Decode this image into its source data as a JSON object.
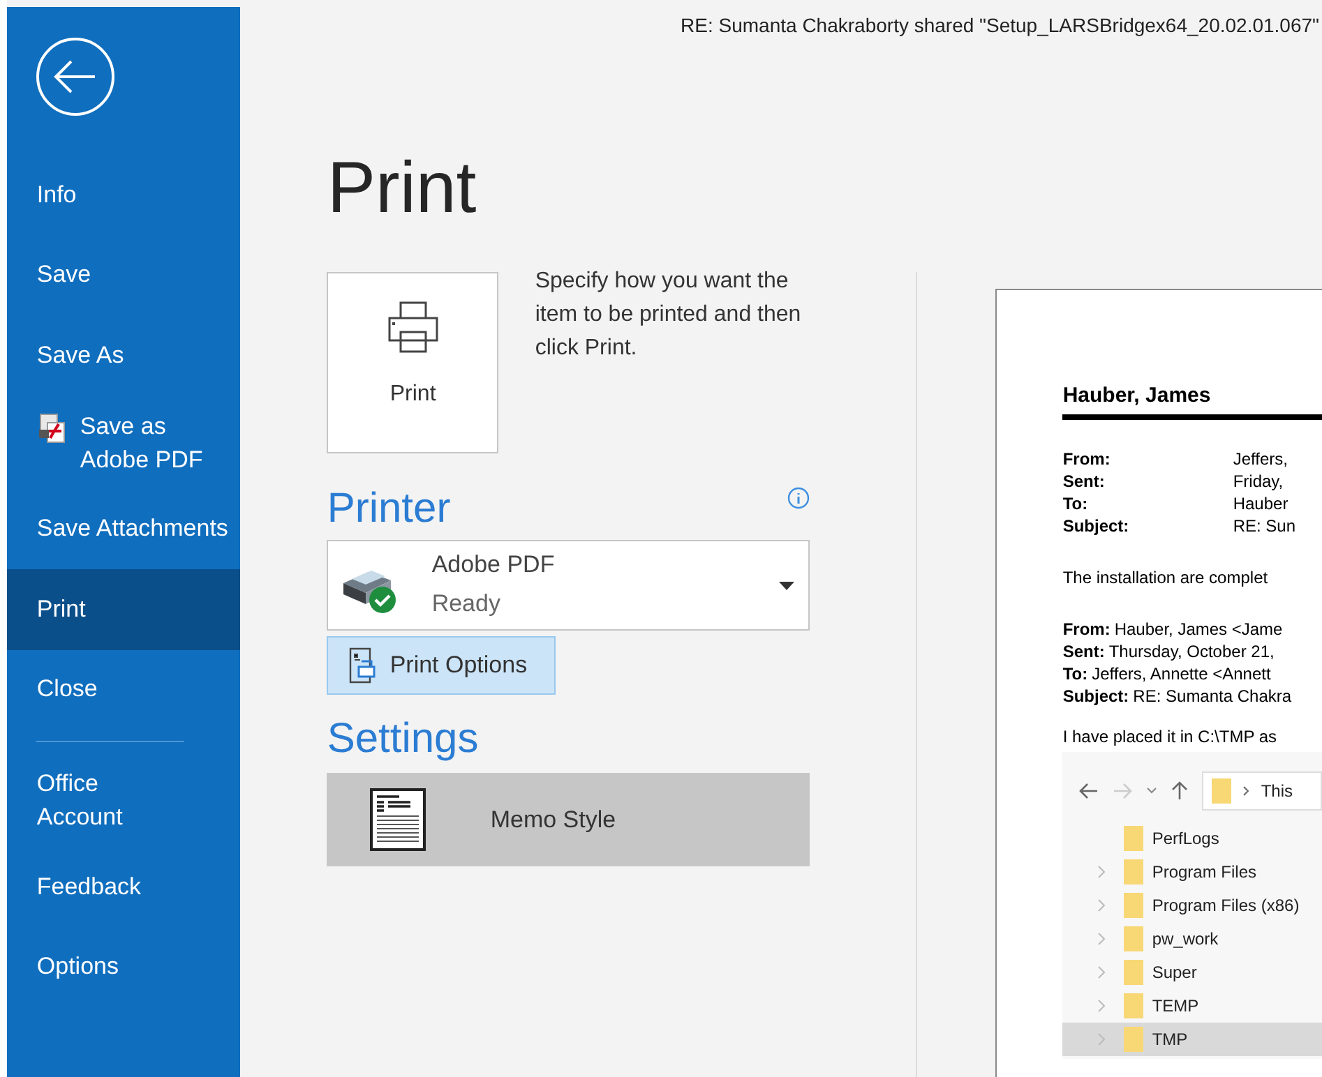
{
  "window": {
    "title": "RE: Sumanta Chakraborty shared \"Setup_LARSBridgex64_20.02.01.067\""
  },
  "sidebar": {
    "items": [
      {
        "label": "Info",
        "selected": false,
        "kind": "item"
      },
      {
        "label": "Save",
        "selected": false,
        "kind": "item"
      },
      {
        "label": "Save As",
        "selected": false,
        "kind": "item"
      },
      {
        "label": "Save as\nAdobe PDF",
        "selected": false,
        "kind": "pdf"
      },
      {
        "label": "Save Attachments",
        "selected": false,
        "kind": "item"
      },
      {
        "label": "Print",
        "selected": true,
        "kind": "item"
      },
      {
        "label": "Close",
        "selected": false,
        "kind": "item"
      },
      {
        "kind": "divider"
      },
      {
        "label": "Office\nAccount",
        "selected": false,
        "kind": "item"
      },
      {
        "label": "Feedback",
        "selected": false,
        "kind": "item"
      },
      {
        "label": "Options",
        "selected": false,
        "kind": "item"
      }
    ]
  },
  "heading": "Print",
  "print_button": {
    "label": "Print"
  },
  "print_hint": "Specify how you want the item to be printed and then click Print.",
  "printer": {
    "heading": "Printer",
    "name": "Adobe PDF",
    "status": "Ready",
    "options_button": "Print Options"
  },
  "settings": {
    "heading": "Settings",
    "style": "Memo Style"
  },
  "preview": {
    "sender": "Hauber, James",
    "header": [
      {
        "label": "From:",
        "value": "Jeffers,"
      },
      {
        "label": "Sent:",
        "value": "Friday,"
      },
      {
        "label": "To:",
        "value": "Hauber"
      },
      {
        "label": "Subject:",
        "value": "RE: Sun"
      }
    ],
    "body": "The installation are complet",
    "quoted": [
      {
        "label": "From:",
        "value": "Hauber, James <Jame"
      },
      {
        "label": "Sent:",
        "value": "Thursday, October 21,"
      },
      {
        "label": "To:",
        "value": "Jeffers, Annette <Annett"
      },
      {
        "label": "Subject:",
        "value": "RE: Sumanta Chakra"
      }
    ],
    "note": "I have placed it in C:\\TMP as",
    "explorer": {
      "address": "This",
      "folders": [
        {
          "name": "PerfLogs",
          "expandable": false,
          "selected": false
        },
        {
          "name": "Program Files",
          "expandable": true,
          "selected": false
        },
        {
          "name": "Program Files (x86)",
          "expandable": true,
          "selected": false
        },
        {
          "name": "pw_work",
          "expandable": true,
          "selected": false
        },
        {
          "name": "Super",
          "expandable": true,
          "selected": false
        },
        {
          "name": "TEMP",
          "expandable": true,
          "selected": false
        },
        {
          "name": "TMP",
          "expandable": true,
          "selected": true
        }
      ]
    }
  }
}
